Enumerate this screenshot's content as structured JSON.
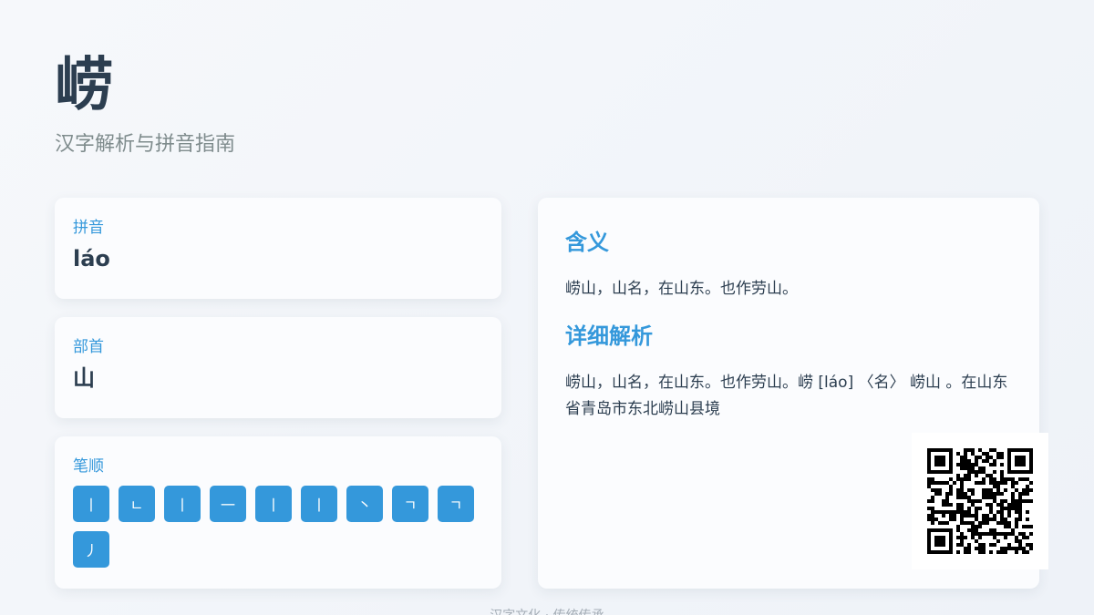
{
  "header": {
    "character": "崂",
    "subtitle": "汉字解析与拼音指南"
  },
  "pinyin_card": {
    "label": "拼音",
    "value": "láo"
  },
  "radical_card": {
    "label": "部首",
    "value": "山"
  },
  "strokes_card": {
    "label": "笔顺",
    "strokes": [
      "丨",
      "ㄴ",
      "丨",
      "一",
      "丨",
      "丨",
      "丶",
      "ㄱ",
      "ㄱ",
      "丿"
    ]
  },
  "meaning_card": {
    "meaning_title": "含义",
    "meaning_text": "崂山，山名，在山东。也作劳山。",
    "detail_title": "详细解析",
    "detail_text": "崂山，山名，在山东。也作劳山。崂 [láo] 〈名〉 崂山 。在山东省青岛市东北崂山县境"
  },
  "footer": {
    "text": "汉字文化 · 传统传承"
  },
  "colors": {
    "accent": "#3498db",
    "text": "#2c3e50",
    "muted": "#7f8c8d"
  }
}
